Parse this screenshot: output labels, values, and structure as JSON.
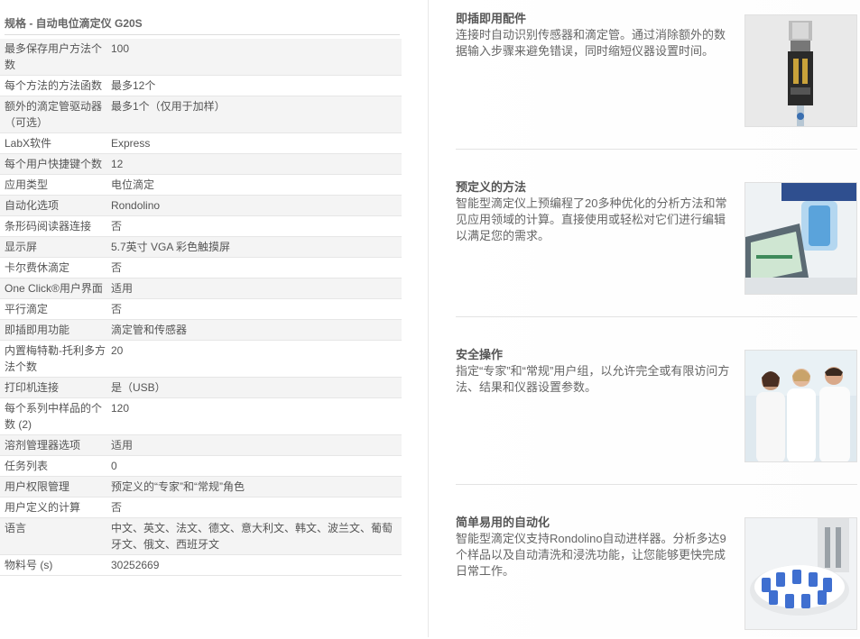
{
  "spec": {
    "title": "规格 - 自动电位滴定仪 G20S",
    "rows": [
      {
        "label": "最多保存用户方法个数",
        "value": "100"
      },
      {
        "label": "每个方法的方法函数",
        "value": "最多12个"
      },
      {
        "label": "额外的滴定管驱动器（可选）",
        "value": "最多1个（仅用于加样）"
      },
      {
        "label": "LabX软件",
        "value": "Express"
      },
      {
        "label": "每个用户快捷键个数",
        "value": "12"
      },
      {
        "label": "应用类型",
        "value": "电位滴定"
      },
      {
        "label": "自动化选项",
        "value": "Rondolino"
      },
      {
        "label": "条形码阅读器连接",
        "value": "否"
      },
      {
        "label": "显示屏",
        "value": "5.7英寸 VGA 彩色触摸屏"
      },
      {
        "label": "卡尔费休滴定",
        "value": "否"
      },
      {
        "label": "One Click®用户界面",
        "value": "适用"
      },
      {
        "label": "平行滴定",
        "value": "否"
      },
      {
        "label": "即插即用功能",
        "value": "滴定管和传感器"
      },
      {
        "label": "内置梅特勒-托利多方法个数",
        "value": "20"
      },
      {
        "label": "打印机连接",
        "value": "是（USB）"
      },
      {
        "label": "每个系列中样品的个数 (2)",
        "value": "120"
      },
      {
        "label": "溶剂管理器选项",
        "value": "适用"
      },
      {
        "label": "任务列表",
        "value": "0"
      },
      {
        "label": "用户权限管理",
        "value": "预定义的“专家”和“常规”角色"
      },
      {
        "label": "用户定义的计算",
        "value": "否"
      },
      {
        "label": "语言",
        "value": "中文、英文、法文、德文、意大利文、韩文、波兰文、葡萄牙文、俄文、西班牙文"
      },
      {
        "label": "物料号 (s)",
        "value": "30252669"
      }
    ]
  },
  "features": [
    {
      "title": "即插即用配件",
      "text": "连接时自动识别传感器和滴定管。通过消除额外的数据输入步骤来避免错误，同时缩短仪器设置时间。",
      "icon": "sensor-burette-image"
    },
    {
      "title": "预定义的方法",
      "text": "智能型滴定仪上预编程了20多种优化的分析方法和常见应用领域的计算。直接使用或轻松对它们进行编辑以满足您的需求。",
      "icon": "titrator-screen-image"
    },
    {
      "title": "安全操作",
      "text": "指定“专家”和“常规”用户组，以允许完全或有限访问方法、结果和仪器设置参数。",
      "icon": "lab-scientists-image"
    },
    {
      "title": "简单易用的自动化",
      "text": "智能型滴定仪支持Rondolino自动进样器。分析多达9个样品以及自动清洗和浸洗功能，让您能够更快完成日常工作。",
      "icon": "rondolino-sampler-image"
    }
  ]
}
